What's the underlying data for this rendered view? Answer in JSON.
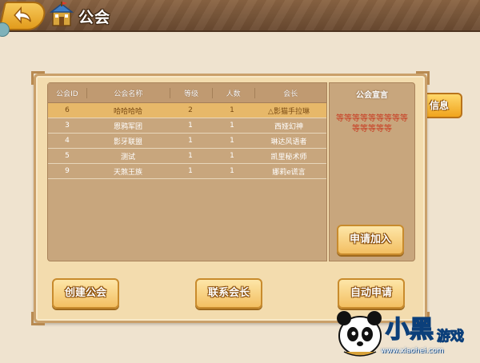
{
  "header": {
    "title": "公会"
  },
  "table": {
    "headers": [
      "公会ID",
      "公会名称",
      "等级",
      "人数",
      "会长"
    ],
    "rows": [
      [
        "6",
        "哈哈哈哈",
        "2",
        "1",
        "△影猫手拉琳"
      ],
      [
        "3",
        "恩鸦军团",
        "1",
        "1",
        "西娅幻神"
      ],
      [
        "4",
        "影牙联盟",
        "1",
        "1",
        "琳达风语者"
      ],
      [
        "5",
        "测试",
        "1",
        "1",
        "凯里秘术师"
      ],
      [
        "9",
        "天煞王族",
        "1",
        "1",
        "娜莉e谎言"
      ]
    ],
    "selected_index": 0
  },
  "declaration": {
    "title": "公会宣言",
    "text": "等等等等等等等等等等等等等等"
  },
  "buttons": {
    "info": "信息",
    "apply_join": "申请加入",
    "create_guild": "创建公会",
    "contact_leader": "联系会长",
    "auto_apply": "自动申请"
  },
  "watermark": {
    "url": "www.xiaohei.com"
  },
  "colors": {
    "selected_row": "#e7b869",
    "declaration_text": "#c8391f"
  }
}
